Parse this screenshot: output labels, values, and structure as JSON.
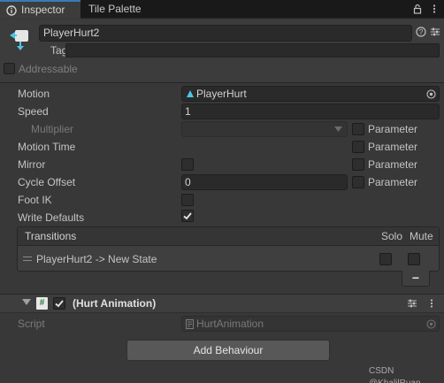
{
  "tabs": [
    {
      "label": "Inspector",
      "active": true,
      "icon": "info-icon"
    },
    {
      "label": "Tile Palette",
      "active": false
    }
  ],
  "window_buttons": [
    "lock-icon",
    "kebab-menu-icon"
  ],
  "header": {
    "name": "PlayerHurt2",
    "tag_label": "Tag",
    "tag_value": "",
    "addressable_label": "Addressable",
    "addressable_checked": false,
    "icon": "animator-state-icon",
    "buttons": [
      "help-icon",
      "preset-icon",
      "more-icon"
    ]
  },
  "properties": {
    "motion": {
      "label": "Motion",
      "value": "PlayerHurt",
      "icon": "animation-clip-icon"
    },
    "speed": {
      "label": "Speed",
      "value": "1"
    },
    "multiplier": {
      "label": "Multiplier",
      "value": ""
    },
    "motion_time": {
      "label": "Motion Time"
    },
    "mirror": {
      "label": "Mirror",
      "checked": false
    },
    "cycle_offset": {
      "label": "Cycle Offset",
      "value": "0"
    },
    "foot_ik": {
      "label": "Foot IK",
      "checked": false
    },
    "write_defaults": {
      "label": "Write Defaults",
      "checked": true
    },
    "parameter_label": "Parameter"
  },
  "transitions": {
    "title": "Transitions",
    "solo_label": "Solo",
    "mute_label": "Mute",
    "items": [
      {
        "label": "PlayerHurt2 -> New State",
        "solo": false,
        "mute": false
      }
    ],
    "remove_label": "−"
  },
  "component": {
    "title": "(Hurt Animation)",
    "enabled": true,
    "script_label": "Script",
    "script_value": "HurtAnimation"
  },
  "add_behaviour_label": "Add Behaviour",
  "watermark": "CSDN @KhalilRuan",
  "colors": {
    "accent": "#3a79bb",
    "background": "#383838",
    "tab_bar": "#191919"
  }
}
